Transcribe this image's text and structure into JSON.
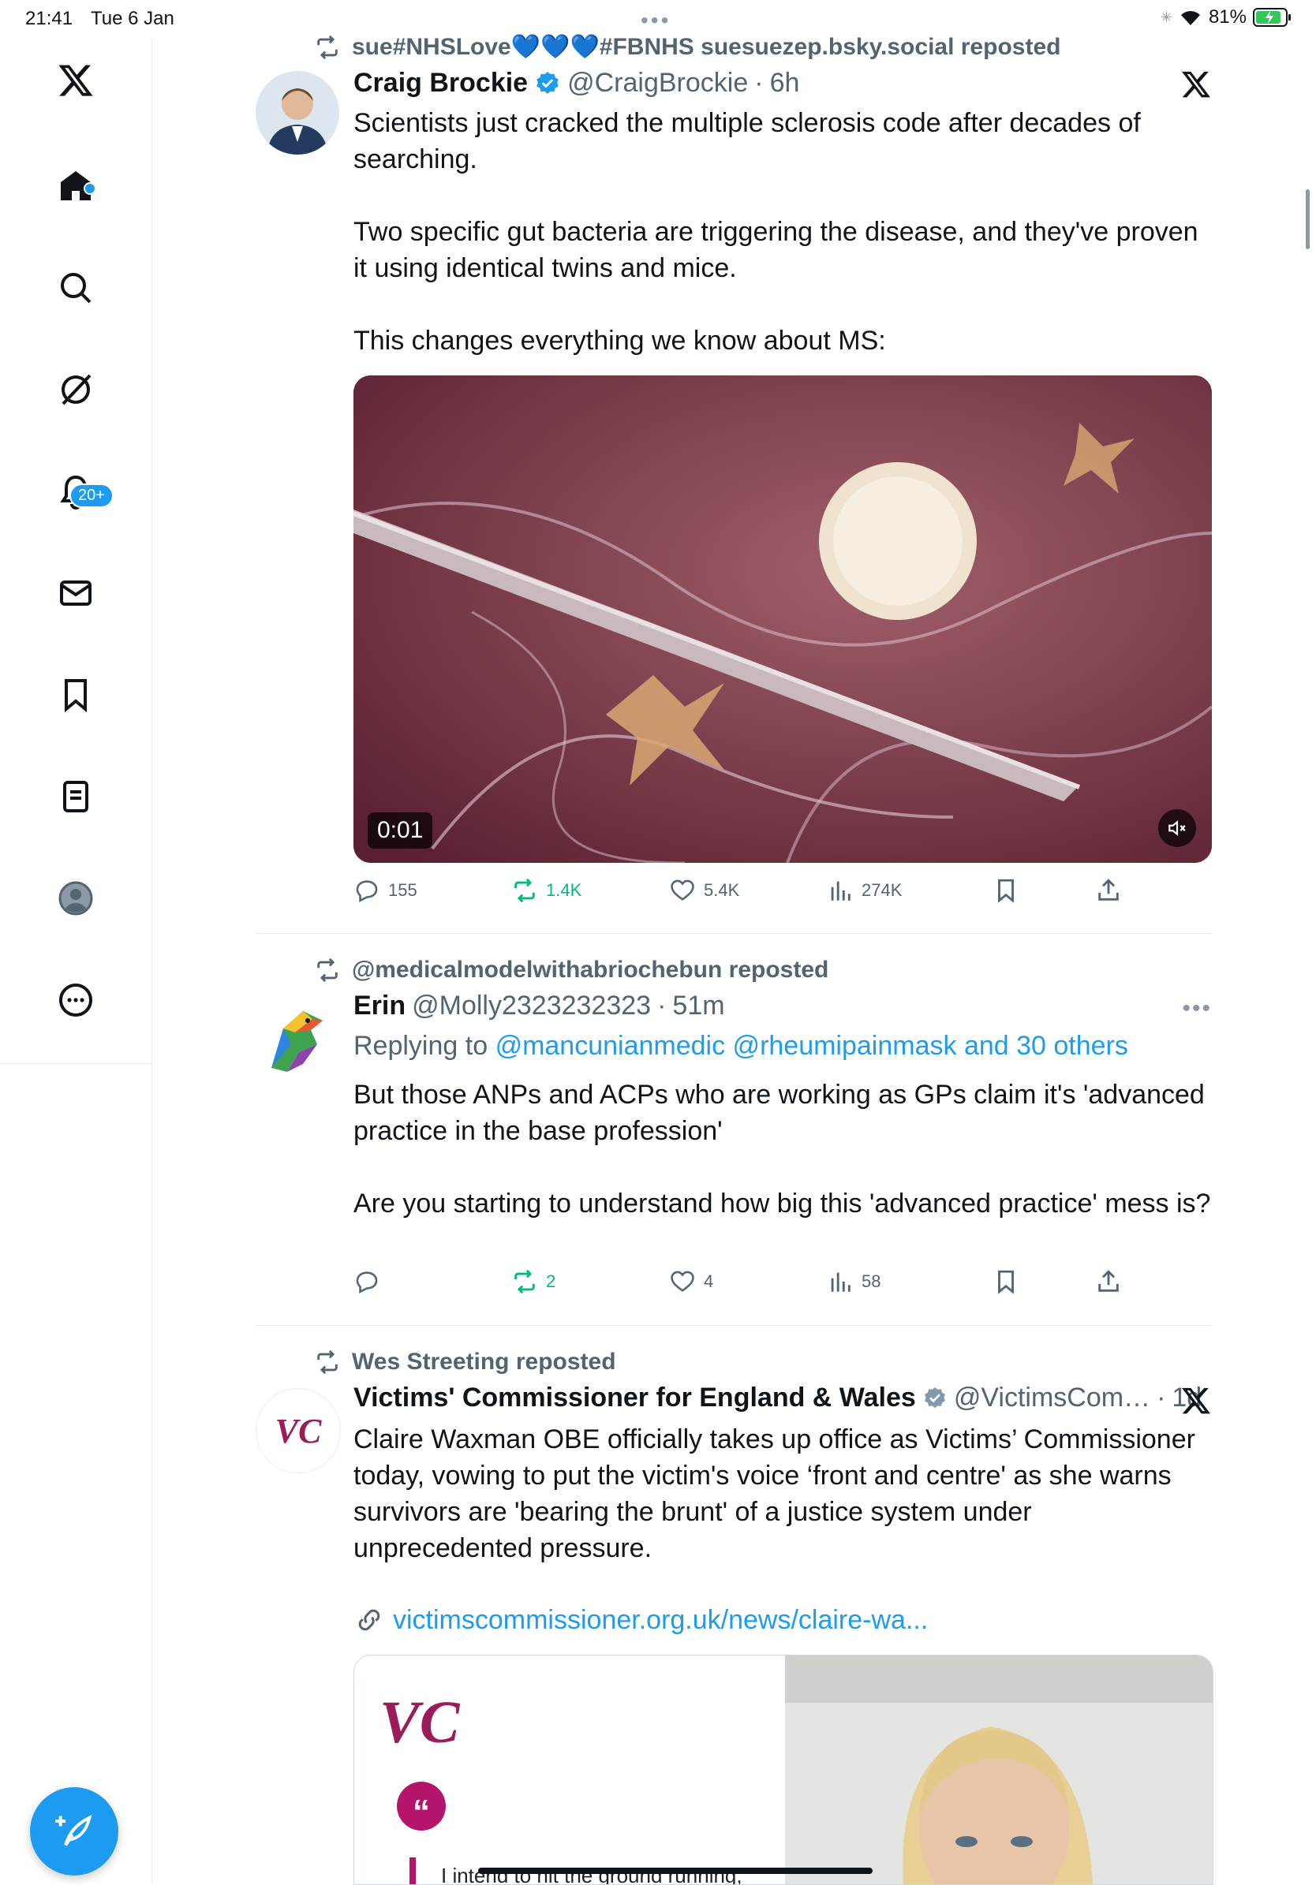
{
  "status_bar": {
    "time": "21:41",
    "date": "Tue 6 Jan",
    "battery": "81%"
  },
  "sidebar": {
    "notification_badge": "20+",
    "items": [
      "x-logo",
      "home",
      "search",
      "grok",
      "notifications",
      "messages",
      "bookmarks",
      "lists",
      "profile",
      "more"
    ]
  },
  "tweets": [
    {
      "repost_by": "sue#NHSLove💙💙💙#FBNHS suesuezep.bsky.social reposted",
      "name": "Craig Brockie",
      "verified": true,
      "handle": "@CraigBrockie",
      "time": "6h",
      "text": "Scientists just cracked the multiple sclerosis code after decades of searching.\n\nTwo specific gut bacteria are triggering the disease, and they've proven it using identical twins and mice.\n\nThis changes everything we know about MS:",
      "video_time": "0:01",
      "actions": {
        "replies": "155",
        "reposts": "1.4K",
        "likes": "5.4K",
        "views": "274K"
      }
    },
    {
      "repost_by": "@medicalmodelwithabriochebun reposted",
      "name": "Erin",
      "handle": "@Molly2323232323",
      "time": "51m",
      "replying_prefix": "Replying to",
      "replying_to": "@mancunianmedic @rheumipainmask and 30 others",
      "text": "But those ANPs and ACPs who are working as GPs claim it's 'advanced practice in the base profession'\n\nAre you starting to understand how big this 'advanced practice' mess is?",
      "actions": {
        "replies": "",
        "reposts": "2",
        "likes": "4",
        "views": "58"
      }
    },
    {
      "repost_by": "Wes Streeting reposted",
      "name": "Victims' Commissioner for England & Wales",
      "verified": true,
      "handle": "@VictimsCom…",
      "time": "1d",
      "text": "Claire Waxman OBE officially takes up office as Victims’ Commissioner today, vowing to put the victim's voice ‘front and centre' as she warns survivors are 'bearing the brunt' of a justice system under unprecedented pressure.",
      "link": "victimscommissioner.org.uk/news/claire-wa...",
      "card_logo": "VC",
      "card_quote": "I intend to hit the ground running,"
    }
  ],
  "colors": {
    "accent": "#1d9bf0",
    "repost_green": "#00ba7c",
    "secondary_text": "#536471",
    "vc_magenta": "#b5146b"
  }
}
